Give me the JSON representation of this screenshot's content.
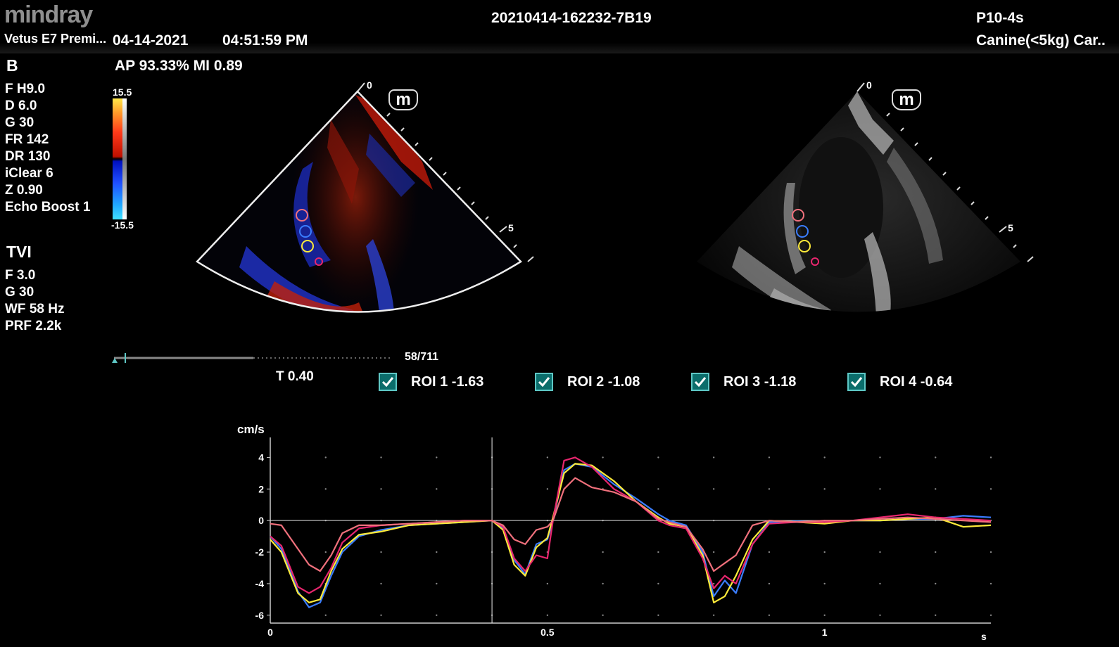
{
  "header": {
    "logo": "mindray",
    "device": "Vetus E7 Premi...",
    "date": "04-14-2021",
    "time": "04:51:59 PM",
    "exam_id": "20210414-162232-7B19",
    "probe": "P10-4s",
    "preset": "Canine(<5kg) Car.."
  },
  "status": {
    "ap_mi": "AP 93.33%   MI 0.89"
  },
  "b_mode": {
    "title": "B",
    "params": [
      "F H9.0",
      "D 6.0",
      "G 30",
      "FR 142",
      "DR 130",
      "iClear 6",
      "Z 0.90",
      "Echo Boost 1"
    ]
  },
  "tvi_mode": {
    "title": "TVI",
    "params": [
      "F 3.0",
      "G 30",
      "WF 58 Hz",
      "PRF 2.2k"
    ]
  },
  "color_scale": {
    "max": "15.5",
    "min": "-15.5"
  },
  "depth_marks": {
    "left_top": "0",
    "left_five": "5",
    "right_top": "0",
    "right_five": "5"
  },
  "icons": {
    "marker_m": "m",
    "checkbox_icon": "checkmark-icon"
  },
  "cine": {
    "frame": "58/711",
    "progress": 0.081
  },
  "cursor_time": "T 0.40",
  "rois": [
    {
      "label": "ROI 1  -1.63",
      "checked": true
    },
    {
      "label": "ROI 2  -1.08",
      "checked": true
    },
    {
      "label": "ROI 3  -1.18",
      "checked": true
    },
    {
      "label": "ROI 4  -0.64",
      "checked": true
    }
  ],
  "chart_data": {
    "type": "line",
    "ylabel": "cm/s",
    "xlabel": "s",
    "xlim": [
      0,
      1.3
    ],
    "ylim": [
      -6.5,
      5
    ],
    "yticks": [
      "4",
      "2",
      "0",
      "-2",
      "-4",
      "-6"
    ],
    "xticks": [
      "0",
      "0.5",
      "1"
    ],
    "cursor_x": 0.4,
    "series": [
      {
        "color": "#3a7dff",
        "x": [
          0,
          0.02,
          0.05,
          0.07,
          0.09,
          0.11,
          0.13,
          0.16,
          0.2,
          0.25,
          0.3,
          0.35,
          0.4,
          0.42,
          0.44,
          0.46,
          0.48,
          0.5,
          0.51,
          0.53,
          0.55,
          0.58,
          0.62,
          0.66,
          0.7,
          0.72,
          0.75,
          0.78,
          0.8,
          0.82,
          0.84,
          0.87,
          0.9,
          0.95,
          1.0,
          1.05,
          1.1,
          1.15,
          1.2,
          1.25,
          1.3
        ],
        "y": [
          -1,
          -1.8,
          -4.5,
          -5.5,
          -5.2,
          -3.5,
          -2,
          -1,
          -0.6,
          -0.3,
          -0.2,
          -0.1,
          0,
          -0.5,
          -2.5,
          -3.4,
          -1.5,
          -1.2,
          0,
          3.2,
          3.6,
          3.4,
          2.3,
          1.4,
          0.4,
          0,
          -0.3,
          -2,
          -4.8,
          -3.8,
          -4.6,
          -1.5,
          -0.1,
          -0.05,
          -0.1,
          0,
          0,
          0.1,
          0.1,
          0.3,
          0.2
        ]
      },
      {
        "color": "#ffeb3a",
        "x": [
          0,
          0.02,
          0.05,
          0.07,
          0.09,
          0.11,
          0.13,
          0.16,
          0.2,
          0.25,
          0.3,
          0.35,
          0.4,
          0.42,
          0.44,
          0.46,
          0.48,
          0.5,
          0.51,
          0.53,
          0.55,
          0.58,
          0.62,
          0.66,
          0.7,
          0.72,
          0.75,
          0.78,
          0.8,
          0.82,
          0.84,
          0.87,
          0.9,
          0.95,
          1.0,
          1.05,
          1.1,
          1.15,
          1.2,
          1.25,
          1.3
        ],
        "y": [
          -1.2,
          -2,
          -4.6,
          -5.2,
          -5,
          -3.2,
          -1.8,
          -0.9,
          -0.7,
          -0.3,
          -0.2,
          -0.1,
          0,
          -0.6,
          -2.8,
          -3.5,
          -1.7,
          -1.1,
          0.2,
          3,
          3.6,
          3.5,
          2.5,
          1.2,
          0.2,
          -0.2,
          -0.4,
          -2.2,
          -5.2,
          -4.8,
          -3.5,
          -1.2,
          0,
          -0.1,
          -0.2,
          0,
          0,
          0.1,
          0.2,
          -0.4,
          -0.3
        ]
      },
      {
        "color": "#e8266e",
        "x": [
          0,
          0.02,
          0.05,
          0.07,
          0.09,
          0.11,
          0.13,
          0.16,
          0.2,
          0.25,
          0.3,
          0.35,
          0.4,
          0.42,
          0.44,
          0.46,
          0.48,
          0.5,
          0.51,
          0.53,
          0.55,
          0.58,
          0.62,
          0.66,
          0.7,
          0.72,
          0.75,
          0.78,
          0.8,
          0.82,
          0.84,
          0.87,
          0.9,
          0.95,
          1.0,
          1.05,
          1.1,
          1.15,
          1.2,
          1.25,
          1.3
        ],
        "y": [
          -1,
          -1.6,
          -4.2,
          -4.6,
          -4.2,
          -3,
          -1.4,
          -0.5,
          -0.3,
          -0.2,
          -0.1,
          0,
          0,
          -0.4,
          -2.4,
          -3.2,
          -2.2,
          -2.4,
          0,
          3.8,
          4,
          3.4,
          2,
          1.2,
          0,
          -0.3,
          -0.5,
          -2.4,
          -4.3,
          -3.5,
          -4,
          -1.5,
          -0.2,
          -0.1,
          -0.1,
          0,
          0.2,
          0.4,
          0.2,
          0.1,
          0
        ]
      },
      {
        "color": "#f0707c",
        "x": [
          0,
          0.02,
          0.05,
          0.07,
          0.09,
          0.11,
          0.13,
          0.16,
          0.2,
          0.25,
          0.3,
          0.35,
          0.4,
          0.42,
          0.44,
          0.46,
          0.48,
          0.5,
          0.51,
          0.53,
          0.55,
          0.58,
          0.62,
          0.66,
          0.7,
          0.72,
          0.75,
          0.78,
          0.8,
          0.82,
          0.84,
          0.87,
          0.9,
          0.95,
          1.0,
          1.05,
          1.1,
          1.15,
          1.2,
          1.25,
          1.3
        ],
        "y": [
          -0.2,
          -0.3,
          -1.8,
          -2.8,
          -3.2,
          -2.2,
          -0.8,
          -0.3,
          -0.3,
          -0.2,
          -0.1,
          0,
          0,
          -0.3,
          -1.2,
          -1.5,
          -0.6,
          -0.4,
          0,
          2,
          2.7,
          2.1,
          1.8,
          1.2,
          0.1,
          -0.1,
          -0.4,
          -1.8,
          -3.2,
          -2.7,
          -2.2,
          -0.3,
          0,
          -0.1,
          0,
          0,
          0.1,
          0.2,
          0.1,
          0,
          -0.1
        ]
      }
    ]
  }
}
